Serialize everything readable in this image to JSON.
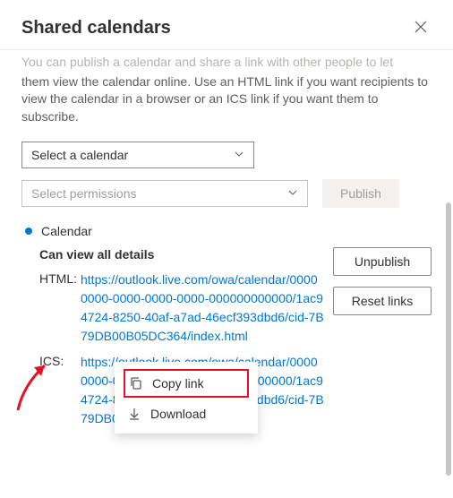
{
  "header": {
    "title": "Shared calendars"
  },
  "description": {
    "truncated": "You can publish a calendar and share a link with other people to let",
    "rest": "them view the calendar online. Use an HTML link if you want recipients to view the calendar in a browser or an ICS link if you want them to subscribe."
  },
  "selectCalendar": {
    "placeholder": "Select a calendar"
  },
  "selectPermissions": {
    "placeholder": "Select permissions"
  },
  "publish": {
    "label": "Publish"
  },
  "calendar": {
    "name": "Calendar",
    "permissionLevel": "Can view all details",
    "links": {
      "htmlLabel": "HTML:",
      "htmlUrl": "https://outlook.live.com/owa/calendar/00000000-0000-0000-0000-000000000000/1ac94724-8250-40af-a7ad-46ecf393dbd6/cid-7B79DB00B05DC364/index.html",
      "icsLabel": "ICS:",
      "icsUrl": "https://outlook.live.com/owa/calendar/00000000-0000-0000-0000-000000000000/1ac94724-8250-40af-a7ad-46ecf393dbd6/cid-7B79DB00B05DC364/calendar.ics"
    },
    "actions": {
      "unpublish": "Unpublish",
      "resetLinks": "Reset links"
    }
  },
  "contextMenu": {
    "copyLink": "Copy link",
    "download": "Download"
  }
}
